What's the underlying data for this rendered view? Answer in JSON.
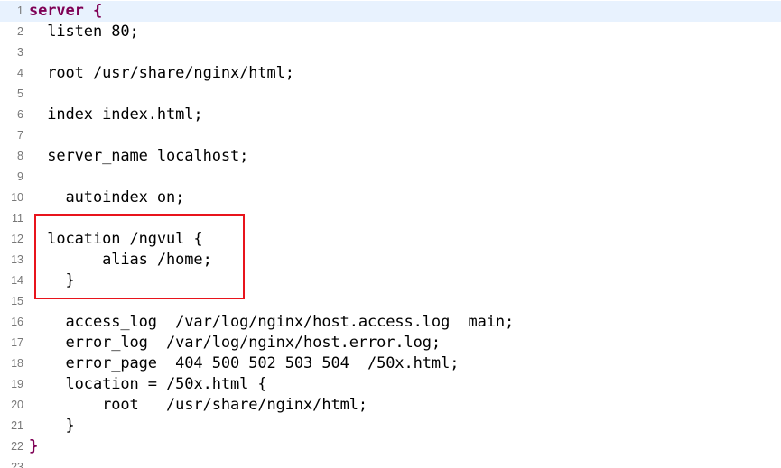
{
  "editor": {
    "current_line": 1,
    "lines": [
      {
        "num": "1",
        "parts": [
          {
            "t": "server",
            "cls": "kw"
          },
          {
            "t": " {",
            "cls": "kw"
          }
        ]
      },
      {
        "num": "2",
        "parts": [
          {
            "t": "  listen 80;"
          }
        ]
      },
      {
        "num": "3",
        "parts": [
          {
            "t": ""
          }
        ]
      },
      {
        "num": "4",
        "parts": [
          {
            "t": "  root /usr/share/nginx/html;"
          }
        ]
      },
      {
        "num": "5",
        "parts": [
          {
            "t": ""
          }
        ]
      },
      {
        "num": "6",
        "parts": [
          {
            "t": "  index index.html;"
          }
        ]
      },
      {
        "num": "7",
        "parts": [
          {
            "t": ""
          }
        ]
      },
      {
        "num": "8",
        "parts": [
          {
            "t": "  server_name localhost;"
          }
        ]
      },
      {
        "num": "9",
        "parts": [
          {
            "t": ""
          }
        ]
      },
      {
        "num": "10",
        "parts": [
          {
            "t": "    autoindex on;"
          }
        ]
      },
      {
        "num": "11",
        "parts": [
          {
            "t": ""
          }
        ]
      },
      {
        "num": "12",
        "parts": [
          {
            "t": "  location /ngvul {"
          }
        ]
      },
      {
        "num": "13",
        "parts": [
          {
            "t": "        alias /home;"
          }
        ]
      },
      {
        "num": "14",
        "parts": [
          {
            "t": "    }"
          }
        ]
      },
      {
        "num": "15",
        "parts": [
          {
            "t": ""
          }
        ]
      },
      {
        "num": "16",
        "parts": [
          {
            "t": "    access_log  /var/log/nginx/host.access.log  main;"
          }
        ]
      },
      {
        "num": "17",
        "parts": [
          {
            "t": "    error_log  /var/log/nginx/host.error.log;"
          }
        ]
      },
      {
        "num": "18",
        "parts": [
          {
            "t": "    error_page  404 500 502 503 504  /50x.html;"
          }
        ]
      },
      {
        "num": "19",
        "parts": [
          {
            "t": "    location "
          },
          {
            "t": "=",
            "cls": "op"
          },
          {
            "t": " /50x.html {"
          }
        ]
      },
      {
        "num": "20",
        "parts": [
          {
            "t": "        root   /usr/share/nginx/html;"
          }
        ]
      },
      {
        "num": "21",
        "parts": [
          {
            "t": "    }"
          }
        ]
      },
      {
        "num": "22",
        "parts": [
          {
            "t": "}",
            "cls": "kw"
          }
        ]
      },
      {
        "num": "23",
        "parts": [
          {
            "t": ""
          }
        ]
      }
    ]
  },
  "highlight": {
    "color": "#e8141c",
    "lines": [
      "12",
      "13",
      "14"
    ]
  },
  "colors": {
    "keyword": "#7f0055",
    "line_number": "#787878",
    "current_line_bg": "#e8f2fe"
  }
}
